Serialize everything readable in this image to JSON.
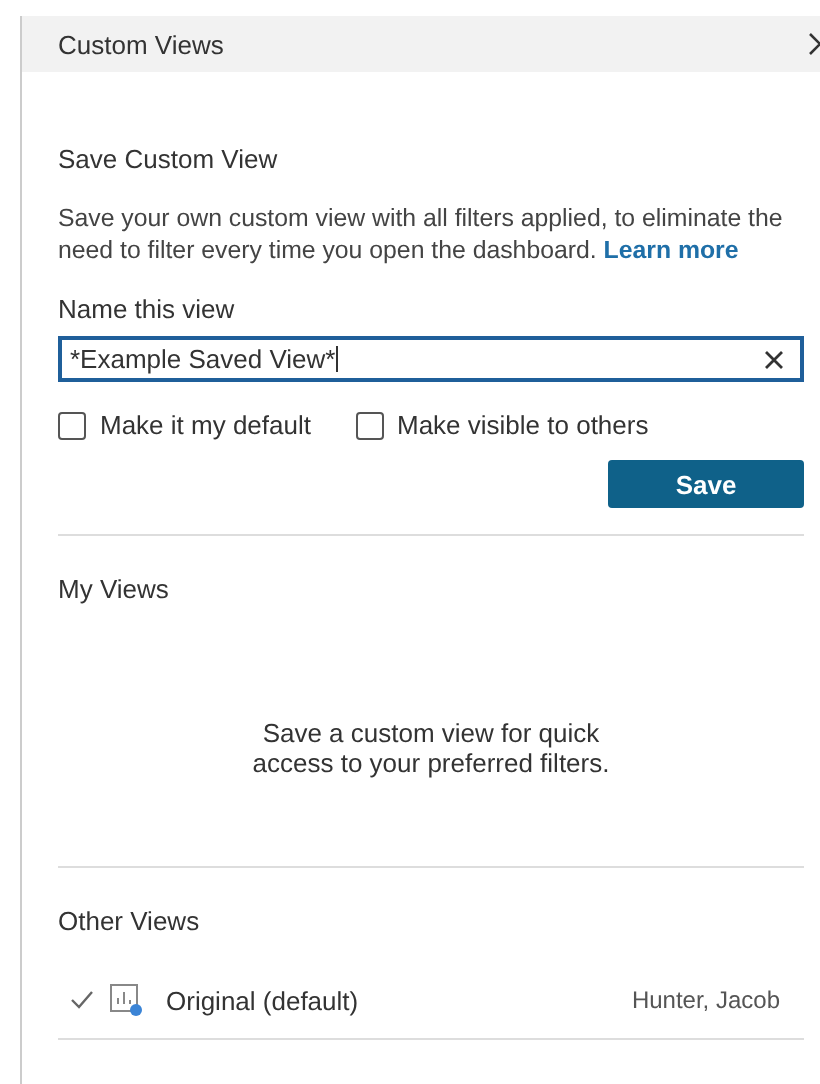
{
  "panel": {
    "title": "Custom Views"
  },
  "save_section": {
    "heading": "Save Custom View",
    "description": "Save your own custom view with all filters applied, to eliminate the need to filter every time you open the dashboard.",
    "link": "Learn more",
    "name_label": "Name this view",
    "name_value": "*Example Saved View*",
    "options": [
      {
        "label": "Make it my default",
        "checked": false
      },
      {
        "label": "Make visible to others",
        "checked": false
      }
    ],
    "save_button": "Save"
  },
  "my_views": {
    "heading": "My Views",
    "empty_message": "Save a custom view for quick access to your preferred filters."
  },
  "other_views": {
    "heading": "Other Views",
    "items": [
      {
        "name": "Original (default)",
        "owner": "Hunter, Jacob",
        "selected": true
      }
    ]
  }
}
